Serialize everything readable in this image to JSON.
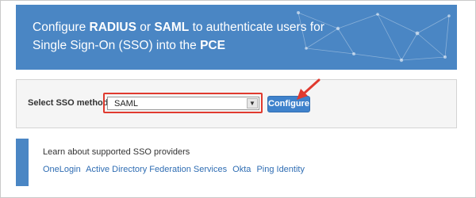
{
  "banner": {
    "title_pre": "Configure ",
    "title_radius": "RADIUS",
    "title_or": " or ",
    "title_saml": "SAML",
    "title_mid": " to authenticate users for Single Sign-On (SSO) into the ",
    "title_pce": "PCE",
    "background_color": "#4a86c4"
  },
  "sso_form": {
    "label": "Select SSO method",
    "select_value": "SAML",
    "configure_label": "Configure",
    "highlight_color": "#e03a2f"
  },
  "providers": {
    "title": "Learn about supported SSO providers",
    "links": [
      "OneLogin",
      "Active Directory Federation Services",
      "Okta",
      "Ping Identity"
    ],
    "link_color": "#2f6db3"
  }
}
